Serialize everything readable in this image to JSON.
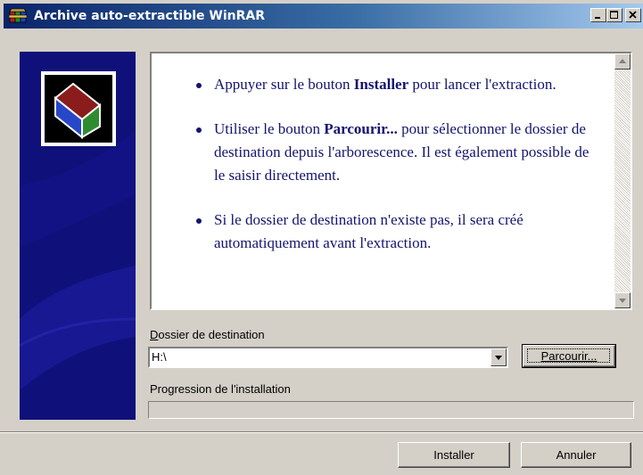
{
  "window": {
    "title": "Archive auto-extractible WinRAR",
    "icon": "winrar-icon",
    "controls": {
      "minimize": "minimize-icon",
      "maximize": "maximize-icon",
      "close": "close-icon"
    }
  },
  "banner": {
    "logo": "winrar-books-icon",
    "background_color": "#10107a"
  },
  "instructions": [
    {
      "before": "Appuyer sur le bouton ",
      "bold": "Installer",
      "after": " pour lancer l'extraction."
    },
    {
      "before": "Utiliser le bouton ",
      "bold": "Parcourir...",
      "after": " pour sélectionner le dossier de destination depuis l'arborescence. Il est également possible de le saisir directement."
    },
    {
      "before": "",
      "bold": "",
      "after": "Si le dossier de destination n'existe pas, il sera créé automatiquement avant l'extraction."
    }
  ],
  "destination": {
    "label": "Dossier de destination",
    "value": "H:\\",
    "browse_label": "Parcourir..."
  },
  "progress": {
    "label": "Progression de l'installation",
    "value": 0
  },
  "buttons": {
    "install": "Installer",
    "cancel": "Annuler"
  },
  "colors": {
    "text_blue": "#14146e",
    "title_gradient_start": "#0a246a",
    "title_gradient_end": "#a6caf0"
  }
}
